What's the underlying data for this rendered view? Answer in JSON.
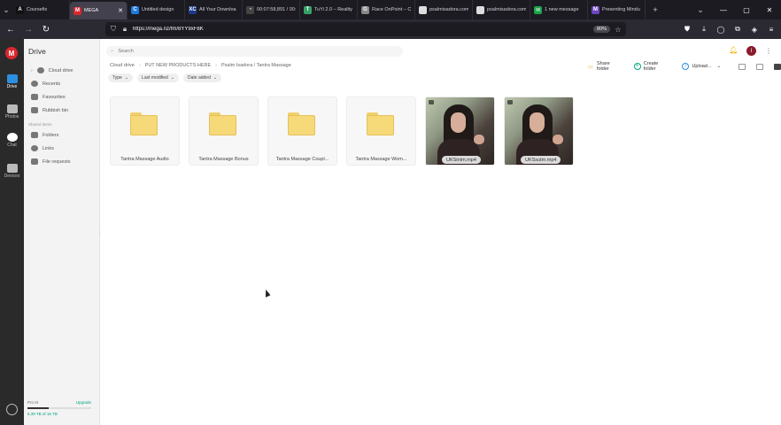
{
  "browser": {
    "tabs": [
      {
        "title": "Coursefix",
        "color": "#111111",
        "glyph": "A"
      },
      {
        "title": "MEGA",
        "color": "#d9272e",
        "glyph": "M",
        "active": true
      },
      {
        "title": "Untitled design",
        "color": "#1f7ae0",
        "glyph": "C"
      },
      {
        "title": "All Your Downloa",
        "color": "#1e3a8a",
        "glyph": "XC"
      },
      {
        "title": "00:07:58,891 / 00:2",
        "color": "#444444",
        "glyph": "◔"
      },
      {
        "title": "TuYi 2.0 – Reality T",
        "color": "#38a169",
        "glyph": "T"
      },
      {
        "title": "Race OnPoint – C",
        "color": "#888888",
        "glyph": "G"
      },
      {
        "title": "psalmisadora.com",
        "color": "#dddddd",
        "glyph": ""
      },
      {
        "title": "psalmisadora.com",
        "color": "#dddddd",
        "glyph": ""
      },
      {
        "title": "1 new message",
        "color": "#1aa34a",
        "glyph": "✉"
      },
      {
        "title": "Presenting Mindu",
        "color": "#6b46c1",
        "glyph": "M"
      }
    ],
    "url": "https://mega.nz/fm/8YY9xF8K",
    "zoom": "80%"
  },
  "rail": {
    "items": [
      {
        "label": "Drive",
        "color": "#2d8fe0"
      },
      {
        "label": "Photos",
        "color": "#bbbbbb"
      },
      {
        "label": "Chat",
        "color": "#ffffff"
      },
      {
        "label": "Devices",
        "color": "#bbbbbb"
      }
    ]
  },
  "sidebar": {
    "title": "Drive",
    "items": [
      {
        "label": "Cloud drive"
      },
      {
        "label": "Recents"
      },
      {
        "label": "Favourites"
      },
      {
        "label": "Rubbish bin"
      }
    ],
    "shared_title": "Shared items",
    "shared": [
      {
        "label": "Folders"
      },
      {
        "label": "Links"
      },
      {
        "label": "File requests"
      }
    ],
    "storage": {
      "plan": "Pro III",
      "upgrade": "Upgrade",
      "used": "5.39 TB of 16 TB",
      "fraction": 0.34
    }
  },
  "main": {
    "search_placeholder": "Search",
    "breadcrumb": [
      "Cloud drive",
      "PUT NEW PRODUCTS HERE",
      "Psalm Isadora / Tantra Massage"
    ],
    "actions": [
      "Share folder",
      "Create folder",
      "Upload..."
    ],
    "filters": [
      "Type",
      "Last modified",
      "Date added"
    ],
    "avatar_letter": "I",
    "items": [
      {
        "type": "folder",
        "name": "Tantra Massage Audio"
      },
      {
        "type": "folder",
        "name": "Tantra Massage Bonus"
      },
      {
        "type": "folder",
        "name": "Tantra Massage Coupl..."
      },
      {
        "type": "folder",
        "name": "Tantra Massage Wom..."
      },
      {
        "type": "video",
        "name": "UKSintm.mp4"
      },
      {
        "type": "video",
        "name": "UKSsutm.mp4"
      }
    ]
  }
}
